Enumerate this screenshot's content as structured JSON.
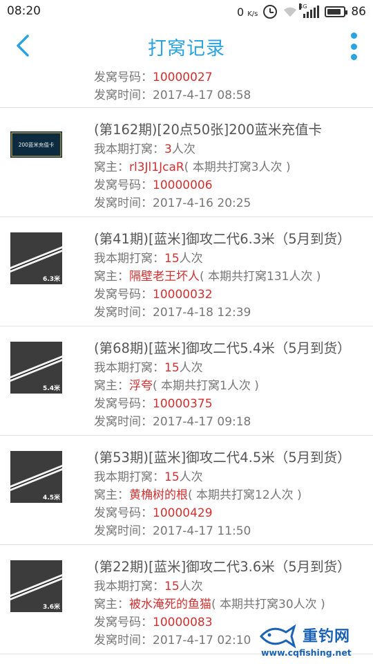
{
  "status_bar": {
    "time": "08:20",
    "speed": "0",
    "speed_unit": "K/s",
    "network": "4G",
    "battery": "86",
    "battery_level": 0.86
  },
  "header": {
    "title": "打窝记录"
  },
  "labels": {
    "my_count": "我本期打窝：",
    "owner": "窝主：",
    "number": "发窝号码：",
    "time": "发窝时间：",
    "times_unit": "人次",
    "owner_total_prefix": "( 本期共打窝",
    "owner_total_suffix": "人次 )"
  },
  "partial_record": {
    "number": "10000027",
    "time": "2017-4-17 08:58"
  },
  "records": [
    {
      "title": "(第162期)[20点50张]200蓝米充值卡",
      "thumb_type": "card",
      "thumb_text": "200蓝米充值卡",
      "my_count": "3",
      "owner": "rl3Jl1JcaR",
      "owner_total": "3",
      "number": "10000006",
      "time": "2017-4-16 20:25"
    },
    {
      "title": "(第41期)[蓝米]御攻二代6.3米（5月到货）",
      "thumb_type": "rod",
      "thumb_text": "6.3米",
      "my_count": "15",
      "owner": "隔壁老王坏人",
      "owner_total": "131",
      "number": "10000032",
      "time": "2017-4-18 12:39"
    },
    {
      "title": "(第68期)[蓝米]御攻二代5.4米（5月到货）",
      "thumb_type": "rod",
      "thumb_text": "5.4米",
      "my_count": "15",
      "owner": "浮夸",
      "owner_total": "1",
      "number": "10000375",
      "time": "2017-4-17 09:18"
    },
    {
      "title": "(第53期)[蓝米]御攻二代4.5米（5月到货）",
      "thumb_type": "rod",
      "thumb_text": "4.5米",
      "my_count": "15",
      "owner": "黄桷树的根",
      "owner_total": "12",
      "number": "10000429",
      "time": "2017-4-17 11:50"
    },
    {
      "title": "(第22期)[蓝米]御攻二代3.6米（5月到货）",
      "thumb_type": "rod",
      "thumb_text": "3.6米",
      "my_count": "15",
      "owner": "被水淹死的鱼猫",
      "owner_total": "30",
      "number": "10000083",
      "time": "2017-4-17 02:10"
    }
  ],
  "watermark": {
    "brand": "重钓网",
    "url": "www.cqfishing.net"
  },
  "colors": {
    "accent": "#2aa3e0",
    "highlight": "#d23030",
    "text_secondary": "#777777",
    "watermark": "#1a62b5"
  }
}
